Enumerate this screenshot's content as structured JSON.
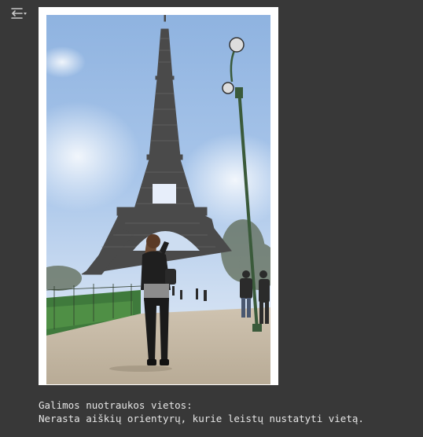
{
  "output": {
    "toggle_icon": "output-collapse-icon",
    "image_alt": "Eiffel Tower photograph",
    "text_lines": [
      "Galimos nuotraukos vietos:",
      "Nerasta aiškių orientyrų, kurie leistų nustatyti vietą."
    ]
  },
  "colors": {
    "background": "#383838",
    "text": "#e6e6e6",
    "icon": "#c8c8c8",
    "card": "#ffffff"
  }
}
